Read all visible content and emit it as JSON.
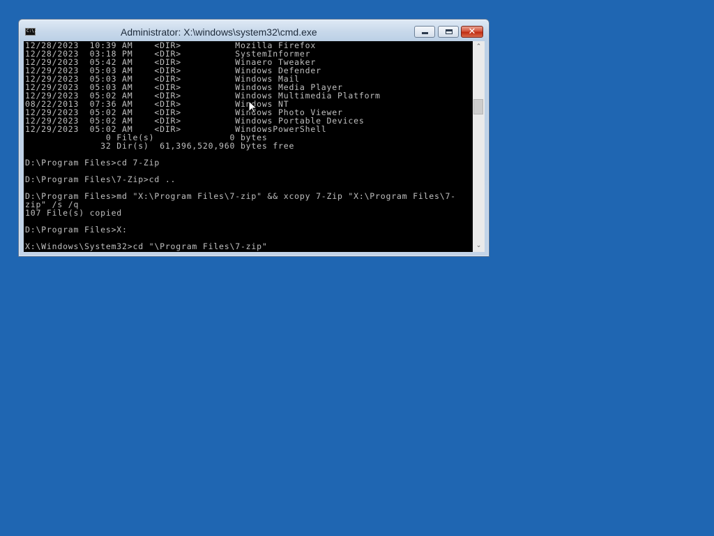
{
  "window": {
    "title": "Administrator: X:\\windows\\system32\\cmd.exe",
    "icon_name": "cmd-icon",
    "icon_text": "C:\\.",
    "controls": {
      "minimize_icon": "minimize-icon",
      "maximize_icon": "maximize-icon",
      "close_icon": "close-icon",
      "close_glyph": "✕"
    }
  },
  "console": {
    "lines": [
      "12/28/2023  10:39 AM    <DIR>          Mozilla Firefox",
      "12/28/2023  03:18 PM    <DIR>          SystemInformer",
      "12/29/2023  05:42 AM    <DIR>          Winaero Tweaker",
      "12/29/2023  05:03 AM    <DIR>          Windows Defender",
      "12/29/2023  05:03 AM    <DIR>          Windows Mail",
      "12/29/2023  05:03 AM    <DIR>          Windows Media Player",
      "12/29/2023  05:02 AM    <DIR>          Windows Multimedia Platform",
      "08/22/2013  07:36 AM    <DIR>          Windows NT",
      "12/29/2023  05:02 AM    <DIR>          Windows Photo Viewer",
      "12/29/2023  05:02 AM    <DIR>          Windows Portable Devices",
      "12/29/2023  05:02 AM    <DIR>          WindowsPowerShell",
      "               0 File(s)              0 bytes",
      "              32 Dir(s)  61,396,520,960 bytes free",
      "",
      "D:\\Program Files>cd 7-Zip",
      "",
      "D:\\Program Files\\7-Zip>cd ..",
      "",
      "D:\\Program Files>md \"X:\\Program Files\\7-zip\" && xcopy 7-Zip \"X:\\Program Files\\7-",
      "zip\" /s /q",
      "107 File(s) copied",
      "",
      "D:\\Program Files>X:",
      "",
      "X:\\Windows\\System32>cd \"\\Program Files\\7-zip\""
    ]
  },
  "scrollbar": {
    "up_glyph": "⌃",
    "down_glyph": "⌄",
    "position_fraction": 0.27
  },
  "colors": {
    "desktop": "#1f66b2",
    "console_bg": "#000000",
    "console_fg": "#c0c0c0"
  }
}
